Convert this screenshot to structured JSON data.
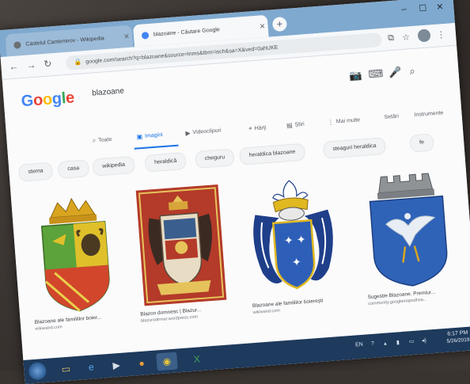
{
  "tabs": [
    {
      "title": "Castelul Cantemirov - Wikipedia",
      "favicon_color": "#6b6f73"
    },
    {
      "title": "blazoane - Căutare Google",
      "favicon_color": "#4285f4"
    }
  ],
  "new_tab_label": "+",
  "window_controls": [
    "–",
    "☐",
    "✕"
  ],
  "address_bar": {
    "url": "google.com/search?q=blazoane&source=lnms&tbm=isch&sa=X&ved=0ahUKE"
  },
  "google": {
    "logo_letters": [
      {
        "ch": "G",
        "color": "#4285f4"
      },
      {
        "ch": "o",
        "color": "#ea4335"
      },
      {
        "ch": "o",
        "color": "#fbbc05"
      },
      {
        "ch": "g",
        "color": "#4285f4"
      },
      {
        "ch": "l",
        "color": "#34a853"
      },
      {
        "ch": "e",
        "color": "#ea4335"
      }
    ],
    "query": "blazoane",
    "search_tabs": [
      {
        "label": "Toate",
        "icon": "search-icon",
        "selected": false
      },
      {
        "label": "Imagini",
        "icon": "image-icon",
        "selected": true
      },
      {
        "label": "Videoclipuri",
        "icon": "video-icon",
        "selected": false
      },
      {
        "label": "Hărți",
        "icon": "map-icon",
        "selected": false
      },
      {
        "label": "Știri",
        "icon": "news-icon",
        "selected": false
      },
      {
        "label": "Mai multe",
        "icon": "more-icon",
        "selected": false
      }
    ],
    "settings_label": "Setări",
    "tools_label": "Instrumente",
    "chips": [
      "stema",
      "casa",
      "wikipedia",
      "heraldică",
      "cheguru",
      "heraldica blazoane",
      "steaguri heraldica",
      "fe"
    ],
    "results": [
      {
        "title": "Blazoane ale familiilor boier...",
        "source": "wikiwand.com"
      },
      {
        "title": "Blazon domnesc | Blazur...",
        "source": "blazurodirmar.wordpress.com"
      },
      {
        "title": "Blazoane ale familiilor boierești",
        "source": "wikiwand.com"
      },
      {
        "title": "Sugestie Blazoane. Premiur...",
        "source": "community.googlemapsdhsa..."
      }
    ]
  },
  "taskbar": {
    "tray_language": "EN",
    "time": "6:17 PM",
    "date": "5/26/2019"
  }
}
